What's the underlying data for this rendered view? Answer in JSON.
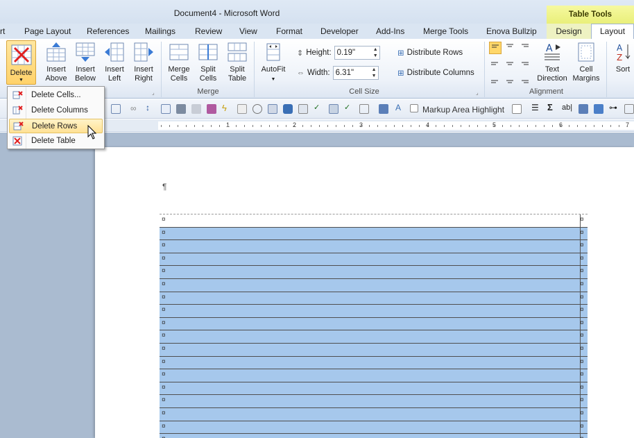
{
  "window": {
    "title": "Document4 - Microsoft Word",
    "context_tab_group": "Table Tools"
  },
  "tabs": [
    {
      "label": "rt"
    },
    {
      "label": "Page Layout"
    },
    {
      "label": "References"
    },
    {
      "label": "Mailings"
    },
    {
      "label": "Review"
    },
    {
      "label": "View"
    },
    {
      "label": "Format"
    },
    {
      "label": "Developer"
    },
    {
      "label": "Add-Ins"
    },
    {
      "label": "Merge Tools"
    },
    {
      "label": "Enova Bullzip"
    },
    {
      "label": "Design"
    },
    {
      "label": "Layout"
    }
  ],
  "ribbon": {
    "rows_columns": {
      "delete": "Delete",
      "insert_above": [
        "Insert",
        "Above"
      ],
      "insert_below": [
        "Insert",
        "Below"
      ],
      "insert_left": [
        "Insert",
        "Left"
      ],
      "insert_right": [
        "Insert",
        "Right"
      ]
    },
    "merge": {
      "label": "Merge",
      "merge_cells": [
        "Merge",
        "Cells"
      ],
      "split_cells": [
        "Split",
        "Cells"
      ],
      "split_table": [
        "Split",
        "Table"
      ]
    },
    "cell_size": {
      "label": "Cell Size",
      "autofit": "AutoFit",
      "height_label": "Height:",
      "height_value": "0.19\"",
      "width_label": "Width:",
      "width_value": "6.31\"",
      "distribute_rows": "Distribute Rows",
      "distribute_columns": "Distribute Columns"
    },
    "alignment": {
      "label": "Alignment",
      "text_direction": [
        "Text",
        "Direction"
      ],
      "cell_margins": [
        "Cell",
        "Margins"
      ]
    },
    "sort": "Sort"
  },
  "toolbar": {
    "markup_area_highlight": "Markup Area Highlight"
  },
  "ruler": {
    "numbers": [
      "1",
      "2",
      "3",
      "4",
      "5",
      "6",
      "7"
    ]
  },
  "delete_menu": {
    "items": [
      {
        "label": "Delete Cells..."
      },
      {
        "label": "Delete Columns"
      },
      {
        "label": "Delete Rows",
        "hovered": true
      },
      {
        "label": "Delete Table"
      }
    ]
  },
  "document": {
    "pilcrow": "¶",
    "cell_marker": "¤",
    "row_count": 18,
    "selected_rows_from": 2
  },
  "colors": {
    "selection": "#a6c8ec",
    "menu_hover": "#ffe195",
    "context_tab": "#e9ef7a"
  }
}
